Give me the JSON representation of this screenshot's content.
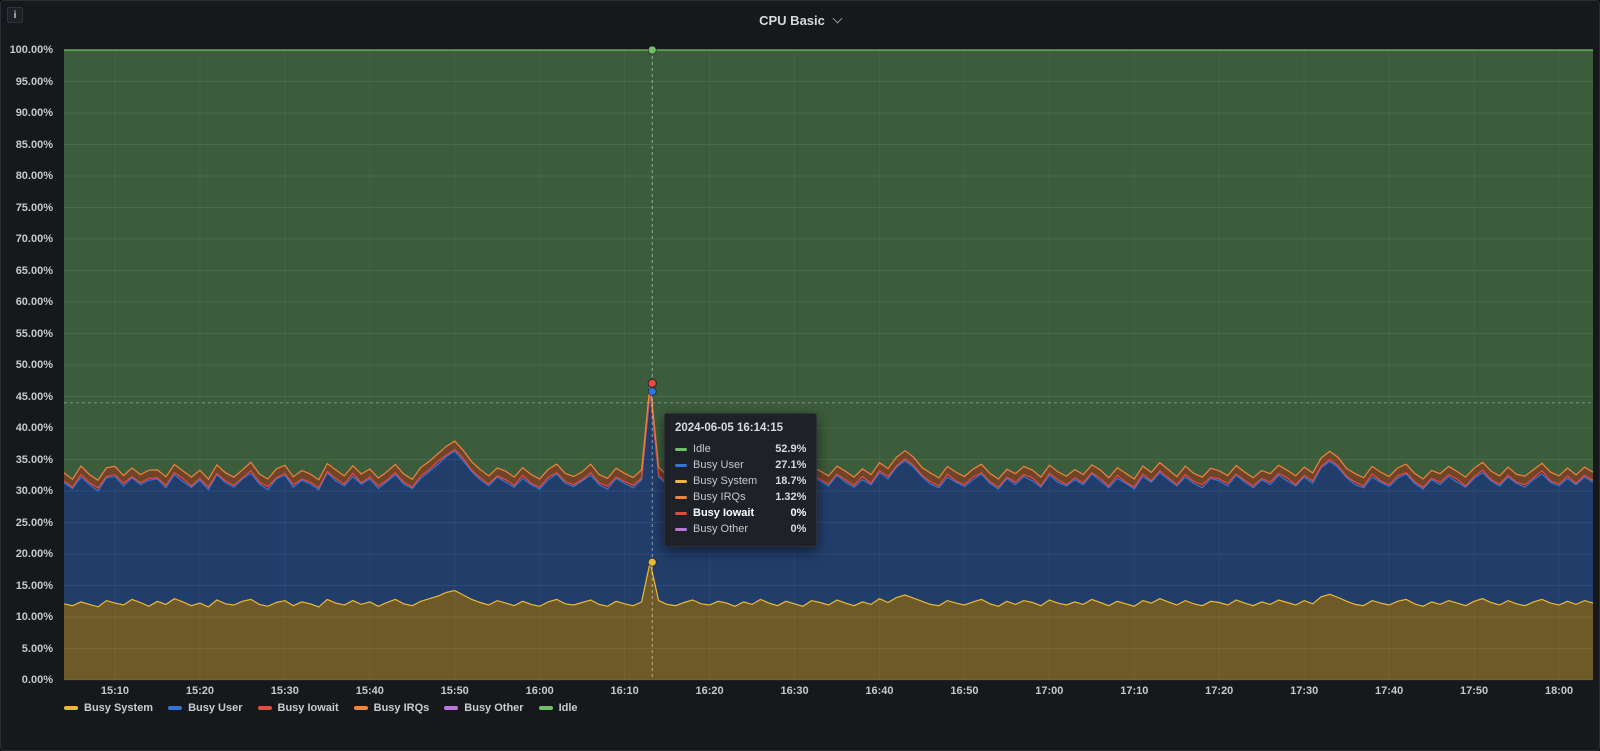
{
  "panel": {
    "title": "CPU Basic",
    "info_icon": "i"
  },
  "tooltip": {
    "timestamp": "2024-06-05 16:14:15",
    "rows": [
      {
        "series": "Idle",
        "value": "52.9%",
        "color": "#73BF69",
        "bold": false
      },
      {
        "series": "Busy User",
        "value": "27.1%",
        "color": "#3274D9",
        "bold": false
      },
      {
        "series": "Busy System",
        "value": "18.7%",
        "color": "#EAB839",
        "bold": false
      },
      {
        "series": "Busy IRQs",
        "value": "1.32%",
        "color": "#EF843C",
        "bold": false
      },
      {
        "series": "Busy Iowait",
        "value": "0%",
        "color": "#E24D42",
        "bold": true
      },
      {
        "series": "Busy Other",
        "value": "0%",
        "color": "#B877D9",
        "bold": false
      }
    ]
  },
  "legend": {
    "items": [
      {
        "label": "Busy System",
        "color": "#EAB839"
      },
      {
        "label": "Busy User",
        "color": "#3274D9"
      },
      {
        "label": "Busy Iowait",
        "color": "#E24D42"
      },
      {
        "label": "Busy IRQs",
        "color": "#EF843C"
      },
      {
        "label": "Busy Other",
        "color": "#B877D9"
      },
      {
        "label": "Idle",
        "color": "#73BF69"
      }
    ]
  },
  "chart_data": {
    "type": "area",
    "stacked": true,
    "title": "CPU Basic",
    "ylim": [
      0,
      100
    ],
    "grid": true,
    "time_start": "15:04",
    "time_end": "18:04",
    "sample_interval_minutes": 1,
    "y_axis": {
      "values": [
        0,
        5,
        10,
        15,
        20,
        25,
        30,
        35,
        40,
        45,
        50,
        55,
        60,
        65,
        70,
        75,
        80,
        85,
        90,
        95,
        100
      ],
      "labels": [
        "0.00%",
        "5.00%",
        "10.00%",
        "15.00%",
        "20.00%",
        "25.00%",
        "30.00%",
        "35.00%",
        "40.00%",
        "45.00%",
        "50.00%",
        "55.00%",
        "60.00%",
        "65.00%",
        "70.00%",
        "75.00%",
        "80.00%",
        "85.00%",
        "90.00%",
        "95.00%",
        "100.00%"
      ]
    },
    "x_axis": {
      "labels": [
        "15:10",
        "15:20",
        "15:30",
        "15:40",
        "15:50",
        "16:00",
        "16:10",
        "16:20",
        "16:30",
        "16:40",
        "16:50",
        "17:00",
        "17:10",
        "17:20",
        "17:30",
        "17:40",
        "17:50",
        "18:00"
      ],
      "indices": [
        6,
        16,
        26,
        36,
        46,
        56,
        66,
        76,
        86,
        96,
        106,
        116,
        126,
        136,
        146,
        156,
        166,
        176
      ]
    },
    "series": [
      {
        "name": "Busy System",
        "color": "#EAB839",
        "values": [
          12.1,
          11.8,
          12.4,
          12.0,
          11.6,
          12.6,
          12.2,
          11.9,
          12.8,
          12.3,
          11.7,
          12.5,
          12.0,
          12.9,
          12.4,
          11.8,
          12.2,
          11.6,
          12.7,
          12.1,
          11.9,
          12.5,
          12.8,
          12.0,
          11.7,
          12.3,
          12.6,
          11.8,
          12.4,
          12.1,
          11.6,
          12.8,
          12.2,
          11.9,
          12.6,
          12.0,
          12.4,
          11.7,
          12.3,
          12.8,
          12.1,
          11.8,
          12.5,
          12.9,
          13.3,
          13.9,
          14.2,
          13.5,
          12.8,
          12.3,
          11.9,
          12.6,
          12.2,
          11.8,
          12.5,
          12.0,
          11.7,
          12.4,
          12.8,
          12.1,
          11.9,
          12.3,
          12.7,
          12.0,
          11.7,
          12.5,
          12.1,
          11.8,
          12.4,
          18.7,
          12.6,
          12.0,
          11.8,
          12.3,
          12.7,
          12.1,
          11.9,
          12.5,
          12.2,
          11.7,
          12.4,
          12.0,
          12.8,
          12.2,
          11.8,
          12.5,
          12.1,
          11.7,
          12.6,
          12.3,
          11.9,
          12.7,
          12.2,
          11.8,
          12.4,
          12.0,
          12.9,
          12.3,
          13.1,
          13.5,
          13.0,
          12.5,
          12.0,
          11.8,
          12.6,
          12.2,
          11.9,
          12.4,
          12.8,
          12.1,
          11.7,
          12.5,
          12.0,
          12.6,
          12.3,
          11.8,
          12.7,
          12.2,
          11.9,
          12.4,
          12.0,
          12.8,
          12.3,
          11.8,
          12.5,
          12.1,
          11.7,
          12.6,
          12.2,
          12.9,
          12.4,
          11.9,
          12.6,
          12.1,
          11.8,
          12.5,
          12.3,
          11.9,
          12.7,
          12.2,
          11.8,
          12.4,
          12.0,
          12.7,
          12.3,
          11.9,
          12.6,
          12.1,
          13.2,
          13.6,
          13.1,
          12.5,
          12.0,
          11.8,
          12.6,
          12.2,
          11.9,
          12.5,
          12.8,
          12.1,
          11.7,
          12.4,
          12.0,
          12.6,
          12.2,
          11.8,
          12.5,
          12.9,
          12.3,
          11.9,
          12.6,
          12.1,
          11.8,
          12.4,
          12.8,
          12.2,
          11.9,
          12.5,
          12.0,
          12.6,
          12.2
        ]
      },
      {
        "name": "Busy User",
        "color": "#3274D9",
        "values": [
          19.2,
          18.6,
          19.8,
          19.0,
          18.4,
          19.5,
          20.1,
          18.9,
          19.3,
          18.7,
          20.0,
          19.4,
          18.5,
          19.7,
          19.1,
          18.8,
          19.5,
          18.6,
          19.9,
          19.2,
          18.7,
          19.4,
          20.0,
          19.1,
          18.5,
          19.6,
          19.9,
          18.8,
          19.3,
          19.0,
          18.6,
          20.1,
          19.4,
          18.9,
          19.7,
          19.1,
          19.5,
          18.7,
          19.2,
          19.8,
          19.0,
          18.6,
          19.5,
          20.2,
          20.9,
          21.6,
          22.1,
          21.3,
          20.3,
          19.5,
          18.9,
          19.6,
          19.2,
          18.8,
          19.5,
          19.0,
          18.6,
          19.4,
          19.9,
          19.1,
          18.8,
          19.3,
          19.8,
          19.0,
          18.6,
          19.5,
          19.1,
          18.7,
          19.4,
          27.1,
          19.6,
          19.0,
          18.7,
          19.3,
          19.8,
          19.1,
          18.8,
          19.5,
          19.2,
          18.6,
          19.4,
          19.0,
          19.9,
          19.2,
          18.7,
          19.5,
          19.1,
          18.6,
          19.7,
          19.3,
          18.9,
          19.8,
          19.2,
          18.8,
          19.4,
          19.0,
          20.0,
          19.6,
          20.7,
          21.3,
          20.8,
          19.8,
          19.1,
          18.7,
          19.6,
          19.2,
          18.8,
          19.4,
          19.9,
          19.1,
          18.6,
          19.5,
          19.0,
          19.7,
          19.3,
          18.8,
          19.8,
          19.2,
          18.9,
          19.4,
          19.0,
          19.9,
          19.3,
          18.7,
          19.5,
          19.1,
          18.6,
          19.7,
          19.2,
          20.0,
          19.4,
          18.9,
          19.6,
          19.1,
          18.7,
          19.5,
          19.3,
          18.9,
          19.8,
          19.2,
          18.7,
          19.4,
          19.0,
          19.8,
          19.3,
          18.9,
          19.6,
          19.1,
          20.5,
          21.1,
          20.6,
          19.6,
          19.0,
          18.7,
          19.6,
          19.2,
          18.8,
          19.5,
          19.9,
          19.1,
          18.6,
          19.4,
          19.0,
          19.7,
          19.2,
          18.8,
          19.5,
          20.0,
          19.3,
          18.9,
          19.6,
          19.1,
          18.8,
          19.4,
          19.9,
          19.2,
          18.9,
          19.5,
          19.0,
          19.6,
          19.2
        ]
      },
      {
        "name": "Busy Iowait",
        "color": "#E24D42",
        "values": [
          0.3,
          0.2,
          0.4,
          0.3,
          0.5,
          0.2,
          0.3,
          0.4,
          0.2,
          0.3,
          0.3,
          0.2,
          0.4,
          0.3,
          0.5,
          0.2,
          0.3,
          0.4,
          0.2,
          0.3,
          0.3,
          0.2,
          0.4,
          0.3,
          0.5,
          0.2,
          0.3,
          0.4,
          0.2,
          0.3,
          0.3,
          0.2,
          0.4,
          0.3,
          0.5,
          0.2,
          0.3,
          0.4,
          0.2,
          0.3,
          0.3,
          0.2,
          0.4,
          0.3,
          0.5,
          0.2,
          0.3,
          0.4,
          0.2,
          0.3,
          0.3,
          0.2,
          0.4,
          0.3,
          0.5,
          0.2,
          0.3,
          0.4,
          0.2,
          0.3,
          0.3,
          0.2,
          0.4,
          0.3,
          0.5,
          0.2,
          0.3,
          0.4,
          0.2,
          0.0,
          0.3,
          0.2,
          0.4,
          0.3,
          0.5,
          0.2,
          0.3,
          0.4,
          0.2,
          0.3,
          0.3,
          0.2,
          0.4,
          0.3,
          0.5,
          0.2,
          0.3,
          0.4,
          0.2,
          0.3,
          0.3,
          0.2,
          0.4,
          0.3,
          0.5,
          0.2,
          0.3,
          0.4,
          0.2,
          0.3,
          0.3,
          0.2,
          0.4,
          0.3,
          0.5,
          0.2,
          0.3,
          0.4,
          0.2,
          0.3,
          0.3,
          0.2,
          0.4,
          0.3,
          0.5,
          0.2,
          0.3,
          0.4,
          0.2,
          0.3,
          0.3,
          0.2,
          0.4,
          0.3,
          0.5,
          0.2,
          0.3,
          0.4,
          0.2,
          0.3,
          0.3,
          0.2,
          0.4,
          0.3,
          0.5,
          0.2,
          0.3,
          0.4,
          0.2,
          0.3,
          0.3,
          0.2,
          0.4,
          0.3,
          0.5,
          0.2,
          0.3,
          0.4,
          0.2,
          0.3,
          0.3,
          0.2,
          0.4,
          0.3,
          0.5,
          0.2,
          0.3,
          0.4,
          0.2,
          0.3,
          0.3,
          0.2,
          0.4,
          0.3,
          0.5,
          0.2,
          0.3,
          0.4,
          0.2,
          0.3,
          0.3,
          0.2,
          0.4,
          0.3,
          0.5,
          0.2,
          0.3,
          0.4,
          0.2,
          0.3,
          0.3
        ]
      },
      {
        "name": "Busy IRQs",
        "color": "#EF843C",
        "values": [
          1.3,
          1.25,
          1.35,
          1.3,
          1.2,
          1.4,
          1.3,
          1.25,
          1.35,
          1.3,
          1.3,
          1.25,
          1.35,
          1.3,
          1.2,
          1.4,
          1.3,
          1.25,
          1.35,
          1.3,
          1.3,
          1.25,
          1.35,
          1.3,
          1.2,
          1.4,
          1.3,
          1.25,
          1.35,
          1.3,
          1.3,
          1.25,
          1.35,
          1.3,
          1.2,
          1.4,
          1.3,
          1.25,
          1.35,
          1.3,
          1.3,
          1.25,
          1.35,
          1.3,
          1.2,
          1.4,
          1.3,
          1.25,
          1.35,
          1.3,
          1.3,
          1.25,
          1.35,
          1.3,
          1.2,
          1.4,
          1.3,
          1.25,
          1.35,
          1.3,
          1.3,
          1.25,
          1.35,
          1.3,
          1.2,
          1.4,
          1.3,
          1.25,
          1.35,
          1.32,
          1.3,
          1.25,
          1.35,
          1.3,
          1.2,
          1.4,
          1.3,
          1.25,
          1.35,
          1.3,
          1.3,
          1.25,
          1.35,
          1.3,
          1.2,
          1.4,
          1.3,
          1.25,
          1.35,
          1.3,
          1.3,
          1.25,
          1.35,
          1.3,
          1.2,
          1.4,
          1.3,
          1.25,
          1.35,
          1.3,
          1.3,
          1.25,
          1.35,
          1.3,
          1.2,
          1.4,
          1.3,
          1.25,
          1.35,
          1.3,
          1.3,
          1.25,
          1.35,
          1.3,
          1.2,
          1.4,
          1.3,
          1.25,
          1.35,
          1.3,
          1.3,
          1.25,
          1.35,
          1.3,
          1.2,
          1.4,
          1.3,
          1.25,
          1.35,
          1.3,
          1.3,
          1.25,
          1.35,
          1.3,
          1.2,
          1.4,
          1.3,
          1.25,
          1.35,
          1.3,
          1.3,
          1.25,
          1.35,
          1.3,
          1.2,
          1.4,
          1.3,
          1.25,
          1.35,
          1.3,
          1.3,
          1.25,
          1.35,
          1.3,
          1.2,
          1.4,
          1.3,
          1.25,
          1.35,
          1.3,
          1.3,
          1.25,
          1.35,
          1.3,
          1.2,
          1.4,
          1.3,
          1.25,
          1.35,
          1.3,
          1.3,
          1.25,
          1.35,
          1.3,
          1.2,
          1.4,
          1.3,
          1.25,
          1.35,
          1.3,
          1.3
        ]
      },
      {
        "name": "Busy Other",
        "color": "#B877D9",
        "no_line": true,
        "values": [
          0,
          0,
          0,
          0,
          0,
          0,
          0,
          0,
          0,
          0,
          0,
          0,
          0,
          0,
          0,
          0,
          0,
          0,
          0,
          0,
          0,
          0,
          0,
          0,
          0,
          0,
          0,
          0,
          0,
          0,
          0,
          0,
          0,
          0,
          0,
          0,
          0,
          0,
          0,
          0,
          0,
          0,
          0,
          0,
          0,
          0,
          0,
          0,
          0,
          0,
          0,
          0,
          0,
          0,
          0,
          0,
          0,
          0,
          0,
          0,
          0,
          0,
          0,
          0,
          0,
          0,
          0,
          0,
          0,
          0,
          0,
          0,
          0,
          0,
          0,
          0,
          0,
          0,
          0,
          0,
          0,
          0,
          0,
          0,
          0,
          0,
          0,
          0,
          0,
          0,
          0,
          0,
          0,
          0,
          0,
          0,
          0,
          0,
          0,
          0,
          0,
          0,
          0,
          0,
          0,
          0,
          0,
          0,
          0,
          0,
          0,
          0,
          0,
          0,
          0,
          0,
          0,
          0,
          0,
          0,
          0,
          0,
          0,
          0,
          0,
          0,
          0,
          0,
          0,
          0,
          0,
          0,
          0,
          0,
          0,
          0,
          0,
          0,
          0,
          0,
          0,
          0,
          0,
          0,
          0,
          0,
          0,
          0,
          0,
          0,
          0,
          0,
          0,
          0,
          0,
          0,
          0,
          0,
          0,
          0,
          0,
          0,
          0,
          0,
          0,
          0,
          0,
          0,
          0,
          0,
          0,
          0,
          0,
          0,
          0,
          0,
          0,
          0,
          0,
          0,
          0
        ]
      },
      {
        "name": "Idle",
        "color": "#73BF69",
        "complement_to_100": true,
        "note": "Idle = 100 minus sum of busy series (e.g. 52.9% at cursor)"
      }
    ],
    "cursor": {
      "index": 69.25,
      "crosshair_percent": 44.0,
      "dots": [
        {
          "series": "Busy System",
          "color": "#EAB839",
          "stack_value": 18.7
        },
        {
          "series": "Busy User",
          "color": "#3274D9",
          "stack_value": 45.8
        },
        {
          "series": "Busy IRQs",
          "color": "#EF843C",
          "stack_value": 47.1
        },
        {
          "series": "Busy Iowait",
          "color": "#E24D42",
          "stack_value": 47.1
        },
        {
          "series": "Idle",
          "color": "#73BF69",
          "stack_value": 100
        }
      ]
    }
  }
}
